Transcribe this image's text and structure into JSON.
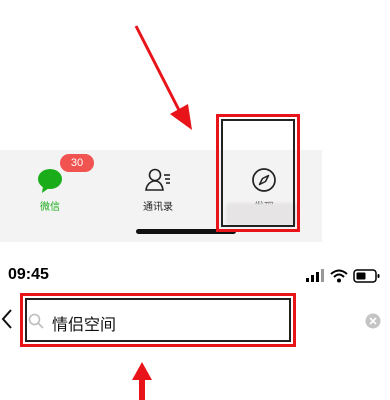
{
  "tabbar": {
    "tabs": [
      {
        "label": "微信",
        "badge": "30",
        "icon": "chat-bubble-icon",
        "active": true
      },
      {
        "label": "通讯录",
        "icon": "contacts-icon",
        "active": false
      },
      {
        "label": "发现",
        "icon": "compass-icon",
        "active": false
      }
    ]
  },
  "status_bar": {
    "time": "09:45",
    "icons": [
      "signal-icon",
      "wifi-icon",
      "battery-icon"
    ]
  },
  "search": {
    "query": "情侣空间",
    "icon": "search-icon",
    "clear_icon": "clear-icon",
    "back_icon": "back-chevron-icon"
  },
  "annotations": {
    "highlight_color": "#e8141a",
    "arrow_color": "#e8141a"
  },
  "colors": {
    "accent_green": "#1aad19",
    "badge_red": "#f05350"
  }
}
